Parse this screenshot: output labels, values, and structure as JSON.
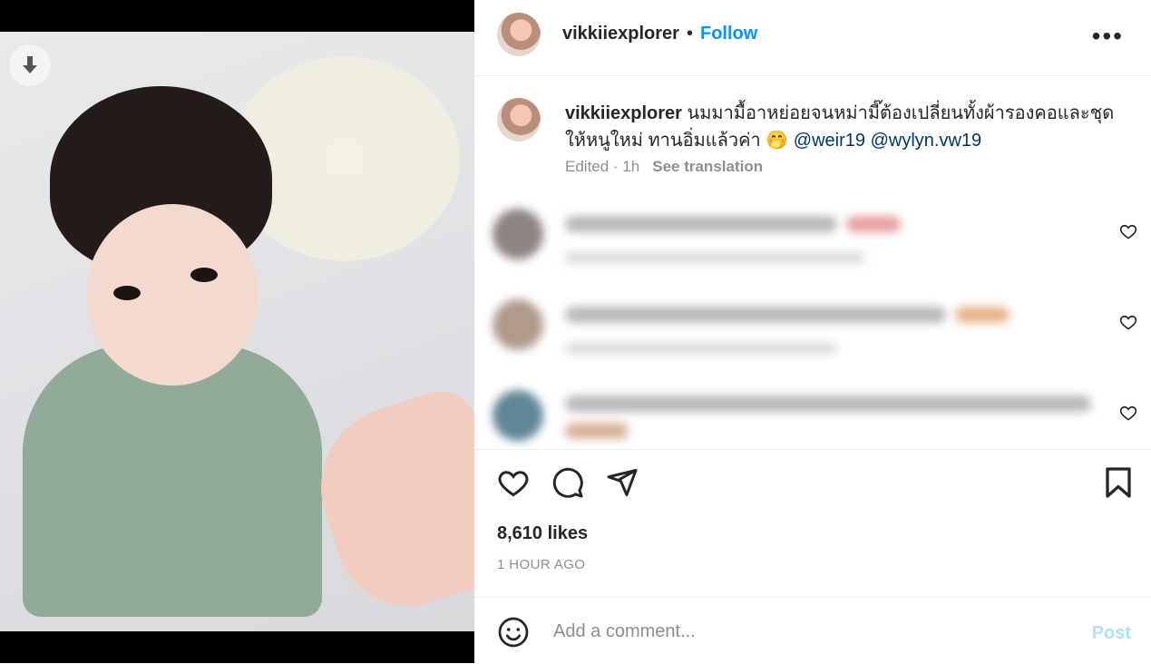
{
  "media": {
    "download_icon": "download-arrow-icon"
  },
  "header": {
    "username": "vikkiiexplorer",
    "separator": "•",
    "follow_label": "Follow",
    "more_label": "•••"
  },
  "caption": {
    "username": "vikkiiexplorer",
    "text": "นมมามื้อาหย่อยจนหม่ามี๊ต้องเปลี่ยนทั้งผ้ารองคอและชุดให้หนูใหม่ ทานอิ่มแล้วค่า 🤭",
    "mentions": [
      "@weir19",
      "@wylyn.vw19"
    ],
    "edited": "Edited · 1h",
    "see_translation": "See translation"
  },
  "comments_blurred": 3,
  "actions": {
    "like_icon": "heart-icon",
    "comment_icon": "comment-bubble-icon",
    "share_icon": "paper-plane-icon",
    "save_icon": "bookmark-icon"
  },
  "likes_text": "8,610 likes",
  "time_text": "1 HOUR AGO",
  "comment_box": {
    "emoji_icon": "smiley-icon",
    "placeholder": "Add a comment...",
    "post_label": "Post"
  },
  "colors": {
    "accent": "#0095f6",
    "post_disabled": "#b2dffc",
    "mention": "#00376b",
    "muted": "#8e8e8e"
  }
}
